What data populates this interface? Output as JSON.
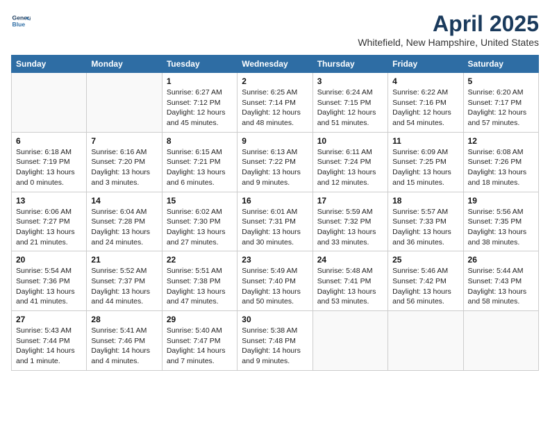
{
  "header": {
    "logo_line1": "General",
    "logo_line2": "Blue",
    "title": "April 2025",
    "subtitle": "Whitefield, New Hampshire, United States"
  },
  "calendar": {
    "columns": [
      "Sunday",
      "Monday",
      "Tuesday",
      "Wednesday",
      "Thursday",
      "Friday",
      "Saturday"
    ],
    "weeks": [
      [
        {
          "day": "",
          "info": ""
        },
        {
          "day": "",
          "info": ""
        },
        {
          "day": "1",
          "info": "Sunrise: 6:27 AM\nSunset: 7:12 PM\nDaylight: 12 hours\nand 45 minutes."
        },
        {
          "day": "2",
          "info": "Sunrise: 6:25 AM\nSunset: 7:14 PM\nDaylight: 12 hours\nand 48 minutes."
        },
        {
          "day": "3",
          "info": "Sunrise: 6:24 AM\nSunset: 7:15 PM\nDaylight: 12 hours\nand 51 minutes."
        },
        {
          "day": "4",
          "info": "Sunrise: 6:22 AM\nSunset: 7:16 PM\nDaylight: 12 hours\nand 54 minutes."
        },
        {
          "day": "5",
          "info": "Sunrise: 6:20 AM\nSunset: 7:17 PM\nDaylight: 12 hours\nand 57 minutes."
        }
      ],
      [
        {
          "day": "6",
          "info": "Sunrise: 6:18 AM\nSunset: 7:19 PM\nDaylight: 13 hours\nand 0 minutes."
        },
        {
          "day": "7",
          "info": "Sunrise: 6:16 AM\nSunset: 7:20 PM\nDaylight: 13 hours\nand 3 minutes."
        },
        {
          "day": "8",
          "info": "Sunrise: 6:15 AM\nSunset: 7:21 PM\nDaylight: 13 hours\nand 6 minutes."
        },
        {
          "day": "9",
          "info": "Sunrise: 6:13 AM\nSunset: 7:22 PM\nDaylight: 13 hours\nand 9 minutes."
        },
        {
          "day": "10",
          "info": "Sunrise: 6:11 AM\nSunset: 7:24 PM\nDaylight: 13 hours\nand 12 minutes."
        },
        {
          "day": "11",
          "info": "Sunrise: 6:09 AM\nSunset: 7:25 PM\nDaylight: 13 hours\nand 15 minutes."
        },
        {
          "day": "12",
          "info": "Sunrise: 6:08 AM\nSunset: 7:26 PM\nDaylight: 13 hours\nand 18 minutes."
        }
      ],
      [
        {
          "day": "13",
          "info": "Sunrise: 6:06 AM\nSunset: 7:27 PM\nDaylight: 13 hours\nand 21 minutes."
        },
        {
          "day": "14",
          "info": "Sunrise: 6:04 AM\nSunset: 7:28 PM\nDaylight: 13 hours\nand 24 minutes."
        },
        {
          "day": "15",
          "info": "Sunrise: 6:02 AM\nSunset: 7:30 PM\nDaylight: 13 hours\nand 27 minutes."
        },
        {
          "day": "16",
          "info": "Sunrise: 6:01 AM\nSunset: 7:31 PM\nDaylight: 13 hours\nand 30 minutes."
        },
        {
          "day": "17",
          "info": "Sunrise: 5:59 AM\nSunset: 7:32 PM\nDaylight: 13 hours\nand 33 minutes."
        },
        {
          "day": "18",
          "info": "Sunrise: 5:57 AM\nSunset: 7:33 PM\nDaylight: 13 hours\nand 36 minutes."
        },
        {
          "day": "19",
          "info": "Sunrise: 5:56 AM\nSunset: 7:35 PM\nDaylight: 13 hours\nand 38 minutes."
        }
      ],
      [
        {
          "day": "20",
          "info": "Sunrise: 5:54 AM\nSunset: 7:36 PM\nDaylight: 13 hours\nand 41 minutes."
        },
        {
          "day": "21",
          "info": "Sunrise: 5:52 AM\nSunset: 7:37 PM\nDaylight: 13 hours\nand 44 minutes."
        },
        {
          "day": "22",
          "info": "Sunrise: 5:51 AM\nSunset: 7:38 PM\nDaylight: 13 hours\nand 47 minutes."
        },
        {
          "day": "23",
          "info": "Sunrise: 5:49 AM\nSunset: 7:40 PM\nDaylight: 13 hours\nand 50 minutes."
        },
        {
          "day": "24",
          "info": "Sunrise: 5:48 AM\nSunset: 7:41 PM\nDaylight: 13 hours\nand 53 minutes."
        },
        {
          "day": "25",
          "info": "Sunrise: 5:46 AM\nSunset: 7:42 PM\nDaylight: 13 hours\nand 56 minutes."
        },
        {
          "day": "26",
          "info": "Sunrise: 5:44 AM\nSunset: 7:43 PM\nDaylight: 13 hours\nand 58 minutes."
        }
      ],
      [
        {
          "day": "27",
          "info": "Sunrise: 5:43 AM\nSunset: 7:44 PM\nDaylight: 14 hours\nand 1 minute."
        },
        {
          "day": "28",
          "info": "Sunrise: 5:41 AM\nSunset: 7:46 PM\nDaylight: 14 hours\nand 4 minutes."
        },
        {
          "day": "29",
          "info": "Sunrise: 5:40 AM\nSunset: 7:47 PM\nDaylight: 14 hours\nand 7 minutes."
        },
        {
          "day": "30",
          "info": "Sunrise: 5:38 AM\nSunset: 7:48 PM\nDaylight: 14 hours\nand 9 minutes."
        },
        {
          "day": "",
          "info": ""
        },
        {
          "day": "",
          "info": ""
        },
        {
          "day": "",
          "info": ""
        }
      ]
    ]
  }
}
